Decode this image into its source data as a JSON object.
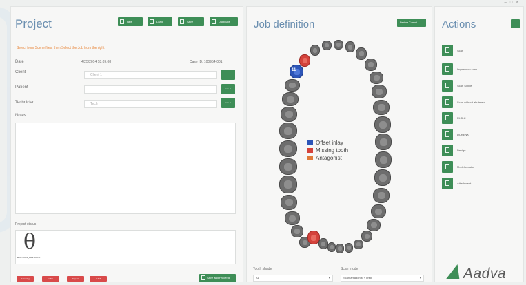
{
  "window": {
    "controls": [
      "–",
      "□",
      "×"
    ]
  },
  "project": {
    "title": "Project",
    "hint": "Select from Scene files, then Select the Job from the right",
    "toolbar": [
      {
        "label": "New",
        "icon": "file-icon"
      },
      {
        "label": "Load",
        "icon": "folder-icon"
      },
      {
        "label": "Save",
        "icon": "save-icon"
      },
      {
        "label": "Duplicate",
        "icon": "duplicate-icon"
      }
    ],
    "fields": {
      "date_label": "Date",
      "date_value": "4/25/2014 18:09:08",
      "case_id": "Case ID: 100954-001",
      "client_label": "Client",
      "client_value": "Client 1",
      "patient_label": "Patient",
      "patient_value": "",
      "technician_label": "Technician",
      "technician_value": "Tech",
      "notes_label": "Notes",
      "dots": "· · ·"
    },
    "status_label": "Project status",
    "status_file": "NEW-SCAN_BRSTA.dcm",
    "status_glyph": "θ",
    "bottom_tabs": [
      "Scanning",
      "CAD",
      "Export",
      "CAM"
    ],
    "save_button": "Save and Proceed"
  },
  "job": {
    "title": "Job definition",
    "header_button": "Restore Current",
    "legend": [
      {
        "label": "Offset inlay",
        "color": "#2d55b8"
      },
      {
        "label": "Missing tooth",
        "color": "#d4423b"
      },
      {
        "label": "Antagonist",
        "color": "#e07a3a"
      }
    ],
    "selected_tooth_label": "11",
    "tooth_shade_label": "Tooth shade",
    "tooth_shade_value": "A1",
    "scan_mode_label": "Scan mode",
    "scan_mode_value": "Scan antagonist + prep"
  },
  "actions": {
    "title": "Actions",
    "items": [
      {
        "label": "Scan"
      },
      {
        "label": "Impression scan"
      },
      {
        "label": "Scan Single"
      },
      {
        "label": "Scan without abutment"
      },
      {
        "label": "Fit Drill"
      },
      {
        "label": "DCRENX"
      },
      {
        "label": "Design"
      },
      {
        "label": "Model creator"
      },
      {
        "label": "Attachment"
      }
    ]
  },
  "brand": {
    "name": "Aadva"
  },
  "colors": {
    "accent_green": "#3e8e57",
    "title_blue": "#6b8fb0",
    "hint_orange": "#e8863a"
  }
}
